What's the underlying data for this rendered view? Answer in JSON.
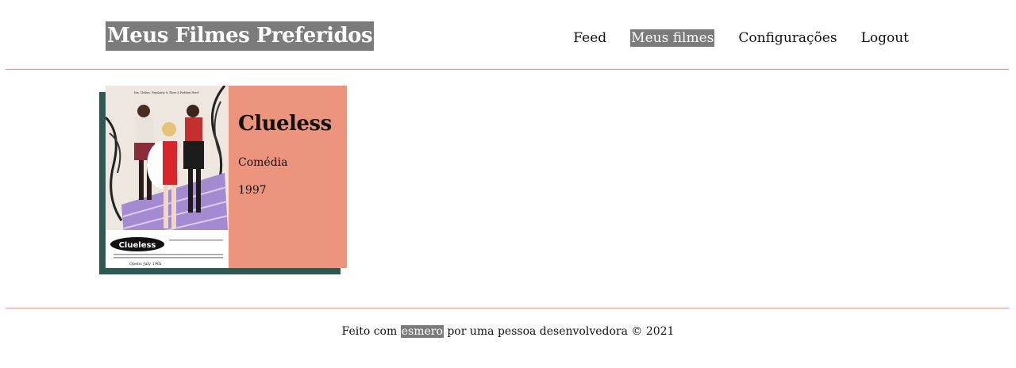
{
  "header": {
    "site_title": "Meus Filmes Preferidos",
    "nav": [
      {
        "label": "Feed",
        "active": false
      },
      {
        "label": "Meus filmes",
        "active": true
      },
      {
        "label": "Configurações",
        "active": false
      },
      {
        "label": "Logout",
        "active": false
      }
    ]
  },
  "movies": [
    {
      "title": "Clueless",
      "genre": "Comédia",
      "year": "1997",
      "poster": {
        "tagline": "Sex. Clothes. Popularity. Is There A Problem Here?",
        "logo_text": "Clueless",
        "release_text": "Opens July 19th"
      }
    }
  ],
  "footer": {
    "text_before": "Feito com",
    "highlight": "esmero",
    "text_after": "por uma pessoa desenvolvedora © 2021"
  },
  "colors": {
    "highlight_bg": "#7b7b7b",
    "rule": "#ee8f88",
    "card_bg": "#ec947e",
    "card_shadow": "#2e5852"
  }
}
